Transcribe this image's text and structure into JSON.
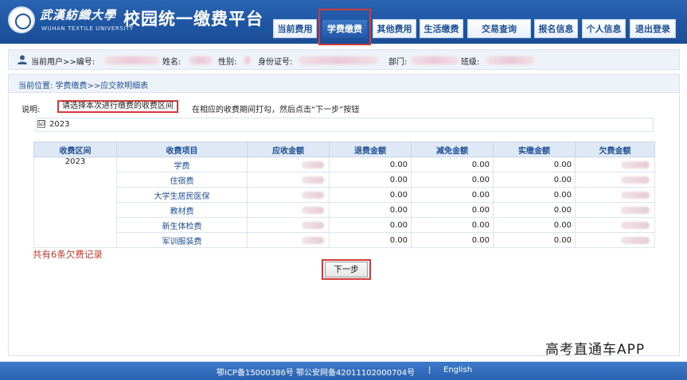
{
  "header": {
    "logo_cn": "武漢紡織大學",
    "logo_en": "WUHAN TEXTILE UNIVERSITY",
    "title": "校园统一缴费平台"
  },
  "nav": {
    "items": [
      {
        "label": "当前费用"
      },
      {
        "label": "学费缴费"
      },
      {
        "label": "其他费用"
      },
      {
        "label": "生活缴费"
      },
      {
        "label": "交易查询"
      },
      {
        "label": "报名信息"
      },
      {
        "label": "个人信息"
      },
      {
        "label": "退出登录"
      }
    ],
    "active": "学费缴费"
  },
  "userbar": {
    "current_user": "当前用户>>编号:",
    "name": "姓名:",
    "gender": "性别:",
    "id_card": "身份证号:",
    "dept": "部门:",
    "class": "班级:"
  },
  "breadcrumb": "当前位置: 学费缴费>>应交款明细表",
  "notice": {
    "label": "说明:",
    "highlight": "请选择本次进行缴费的收费区间",
    "rest": "在相应的收费期间打勾，然后点击“下一步”按钮"
  },
  "period": {
    "checkbox": "☑",
    "label": "2023"
  },
  "table": {
    "headers": [
      "收费区间",
      "收费项目",
      "应收金额",
      "退费金额",
      "减免金额",
      "实缴金额",
      "欠费金额"
    ],
    "period": "2023",
    "rows": [
      {
        "item": "学费",
        "refund": "0.00",
        "reduce": "0.00",
        "paid": "0.00"
      },
      {
        "item": "住宿费",
        "refund": "0.00",
        "reduce": "0.00",
        "paid": "0.00"
      },
      {
        "item": "大学生居民医保",
        "refund": "0.00",
        "reduce": "0.00",
        "paid": "0.00"
      },
      {
        "item": "教材费",
        "refund": "0.00",
        "reduce": "0.00",
        "paid": "0.00"
      },
      {
        "item": "新生体检费",
        "refund": "0.00",
        "reduce": "0.00",
        "paid": "0.00"
      },
      {
        "item": "军训服装费",
        "refund": "0.00",
        "reduce": "0.00",
        "paid": "0.00"
      }
    ]
  },
  "summary": "共有6条欠费记录",
  "next_button": "下一步",
  "watermark": "高考直通车APP",
  "footer": {
    "icp": "鄂ICP备15000386号 鄂公安网备42011102000704号",
    "separator": "|",
    "language": "English"
  },
  "colors": {
    "header_blue": "#1f56a3",
    "highlight_red": "#d23b3b",
    "debt_red": "#c0392b"
  }
}
